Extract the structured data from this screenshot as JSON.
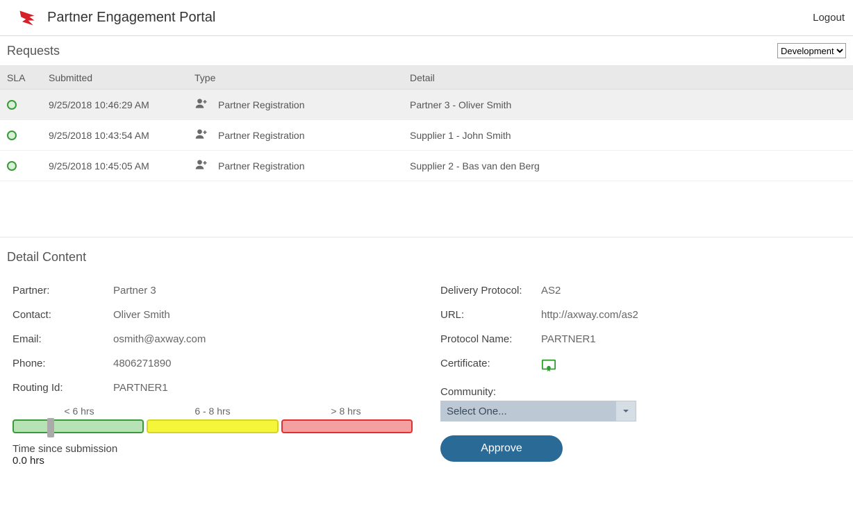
{
  "header": {
    "title": "Partner Engagement Portal",
    "logout": "Logout"
  },
  "requests": {
    "title": "Requests",
    "env_selected": "Development",
    "columns": {
      "sla": "SLA",
      "submitted": "Submitted",
      "type": "Type",
      "detail": "Detail"
    },
    "rows": [
      {
        "submitted": "9/25/2018 10:46:29 AM",
        "type": "Partner Registration",
        "detail": "Partner 3 - Oliver Smith",
        "selected": true
      },
      {
        "submitted": "9/25/2018 10:43:54 AM",
        "type": "Partner Registration",
        "detail": "Supplier 1 - John Smith",
        "selected": false
      },
      {
        "submitted": "9/25/2018 10:45:05 AM",
        "type": "Partner Registration",
        "detail": "Supplier 2 - Bas van den Berg",
        "selected": false
      }
    ]
  },
  "detail": {
    "section_title": "Detail Content",
    "left": {
      "partner_label": "Partner:",
      "partner_value": "Partner 3",
      "contact_label": "Contact:",
      "contact_value": "Oliver Smith",
      "email_label": "Email:",
      "email_value": "osmith@axway.com",
      "phone_label": "Phone:",
      "phone_value": "4806271890",
      "routing_label": "Routing Id:",
      "routing_value": "PARTNER1",
      "sla_labels": {
        "a": "< 6 hrs",
        "b": "6 - 8 hrs",
        "c": "> 8 hrs"
      },
      "time_since_label": "Time since submission",
      "time_since_value": "0.0 hrs"
    },
    "right": {
      "protocol_label": "Delivery Protocol:",
      "protocol_value": "AS2",
      "url_label": "URL:",
      "url_value": "http://axway.com/as2",
      "protoname_label": "Protocol Name:",
      "protoname_value": "PARTNER1",
      "cert_label": "Certificate:",
      "community_label": "Community:",
      "community_placeholder": "Select One...",
      "approve_label": "Approve"
    }
  }
}
